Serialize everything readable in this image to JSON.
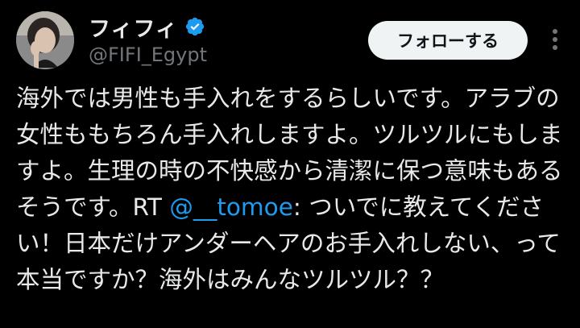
{
  "user": {
    "display_name": "フィフィ",
    "handle": "@FIFI_Egypt",
    "verified_icon": "verified-badge-icon",
    "avatar_icon": "avatar"
  },
  "actions": {
    "follow_label": "フォローする",
    "more_icon": "more-options-icon"
  },
  "tweet": {
    "text_before_mention": "海外では男性も手入れをするらしいです。アラブの女性ももちろん手入れしますよ。ツルツルにもしますよ。生理の時の不快感から清潔に保つ意味もあるそうです。RT ",
    "mention": "@__tomoe",
    "text_after_mention": ": ついでに教えてください！日本だけアンダーヘアのお手入れしない、って本当ですか？海外はみんなツルツル？？"
  },
  "colors": {
    "background": "#000000",
    "text": "#e7e9ea",
    "secondary_text": "#71767b",
    "link": "#1d9bf0",
    "verified": "#1d9bf0",
    "follow_button_bg": "#eff3f4"
  }
}
